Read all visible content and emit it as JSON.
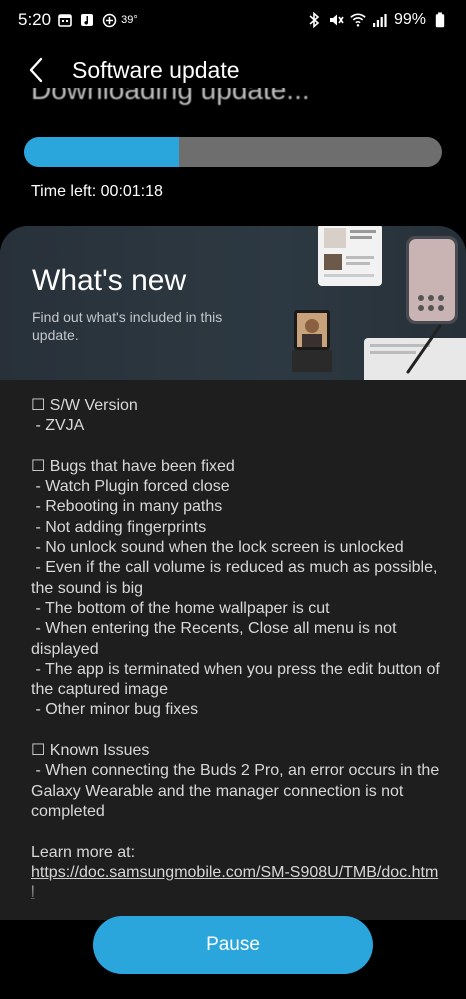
{
  "status_bar": {
    "time": "5:20",
    "temperature": "39°",
    "battery_percent": "99%"
  },
  "header": {
    "title": "Software update"
  },
  "download": {
    "status_text": "Downloading update...",
    "progress_fraction": 0.37,
    "time_left": "Time left: 00:01:18"
  },
  "whats_new": {
    "title": "What's new",
    "subtitle": "Find out what's included in this update."
  },
  "release_notes": {
    "lines": [
      "☐ S/W Version",
      " - ZVJA",
      "",
      "☐ Bugs that have been fixed",
      " - Watch Plugin forced close",
      " - Rebooting in many paths",
      " - Not adding fingerprints",
      " - No unlock sound when the lock screen is unlocked",
      " - Even if the call volume is reduced as much as possible, the sound is big",
      " - The bottom of the home wallpaper is cut",
      " - When entering the Recents, Close all menu is not displayed",
      " - The app is terminated when you press the edit button of the captured image",
      " - Other minor bug fixes",
      "",
      "☐ Known Issues",
      " - When connecting the Buds 2 Pro, an error occurs in the Galaxy Wearable and the manager connection is not completed",
      ""
    ],
    "learn_more_label": "Learn more at:",
    "learn_more_url": "https://doc.samsungmobile.com/SM-S908U/TMB/doc.html"
  },
  "actions": {
    "pause_label": "Pause"
  },
  "colors": {
    "accent": "#2aa6dd",
    "progress_track": "#6e6e6e",
    "card_background": "#1e1e1e",
    "banner_background": "#2d3942"
  }
}
